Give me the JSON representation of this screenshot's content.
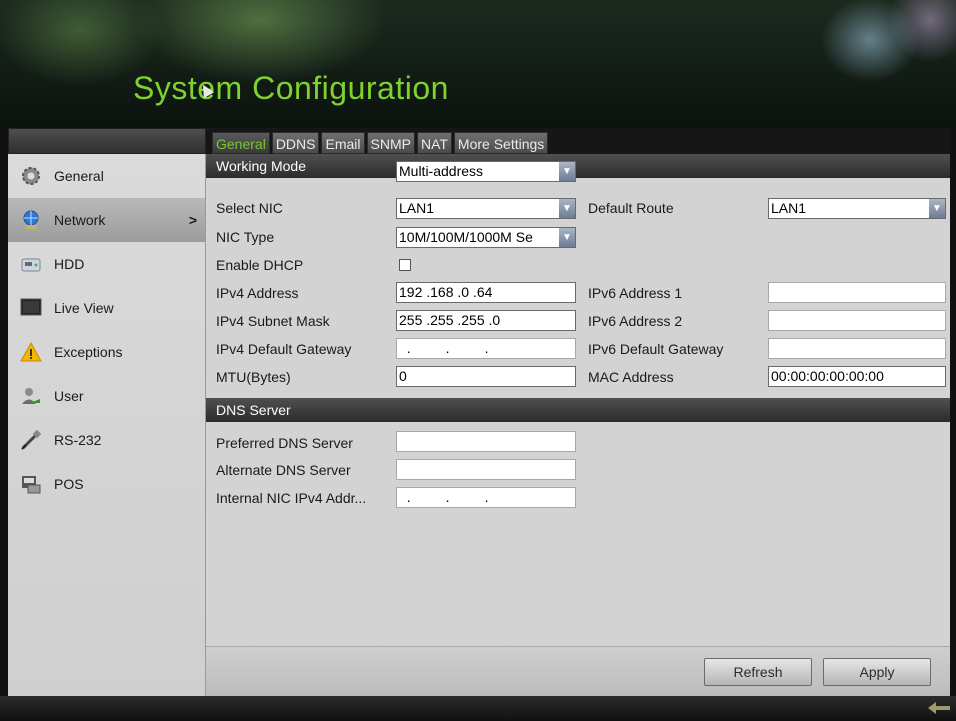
{
  "app": {
    "title": "System Configuration"
  },
  "tabs": [
    "General",
    "DDNS",
    "Email",
    "SNMP",
    "NAT",
    "More Settings"
  ],
  "sidebar": {
    "items": [
      {
        "label": "General",
        "icon": "gear-icon"
      },
      {
        "label": "Network",
        "icon": "network-icon",
        "active": true,
        "chevron": ">"
      },
      {
        "label": "HDD",
        "icon": "hdd-icon"
      },
      {
        "label": "Live View",
        "icon": "monitor-icon"
      },
      {
        "label": "Exceptions",
        "icon": "warning-icon"
      },
      {
        "label": "User",
        "icon": "user-icon"
      },
      {
        "label": "RS-232",
        "icon": "serial-cable-icon"
      },
      {
        "label": "POS",
        "icon": "pos-terminal-icon"
      }
    ]
  },
  "form": {
    "working_mode": {
      "label": "Working Mode",
      "value": "Multi-address"
    },
    "select_nic": {
      "label": "Select NIC",
      "value": "LAN1"
    },
    "default_route": {
      "label": "Default Route",
      "value": "LAN1"
    },
    "nic_type": {
      "label": "NIC Type",
      "value": "10M/100M/1000M Se"
    },
    "enable_dhcp": {
      "label": "Enable DHCP",
      "checked": false
    },
    "ipv4_address": {
      "label": "IPv4 Address",
      "value": "192 .168 .0    .64"
    },
    "ipv4_subnet": {
      "label": "IPv4 Subnet Mask",
      "value": "255 .255 .255 .0"
    },
    "ipv4_gateway": {
      "label": "IPv4 Default Gateway",
      "value": "  .         .         ."
    },
    "mtu": {
      "label": "MTU(Bytes)",
      "value": "0"
    },
    "ipv6_address_1": {
      "label": "IPv6 Address 1",
      "value": ""
    },
    "ipv6_address_2": {
      "label": "IPv6 Address 2",
      "value": ""
    },
    "ipv6_gateway": {
      "label": "IPv6 Default Gateway",
      "value": ""
    },
    "mac_address": {
      "label": "MAC Address",
      "value": "00:00:00:00:00:00"
    }
  },
  "dns": {
    "section_title": "DNS Server",
    "preferred": {
      "label": "Preferred DNS Server",
      "value": ""
    },
    "alternate": {
      "label": "Alternate DNS Server",
      "value": ""
    },
    "internal_nic": {
      "label": "Internal NIC IPv4 Addr...",
      "value": "  .         .         ."
    }
  },
  "footer": {
    "refresh_label": "Refresh",
    "apply_label": "Apply"
  },
  "colors": {
    "accent": "#7fd22d",
    "panel": "#d3d3d3",
    "sidebar": "#d6d6d6"
  }
}
